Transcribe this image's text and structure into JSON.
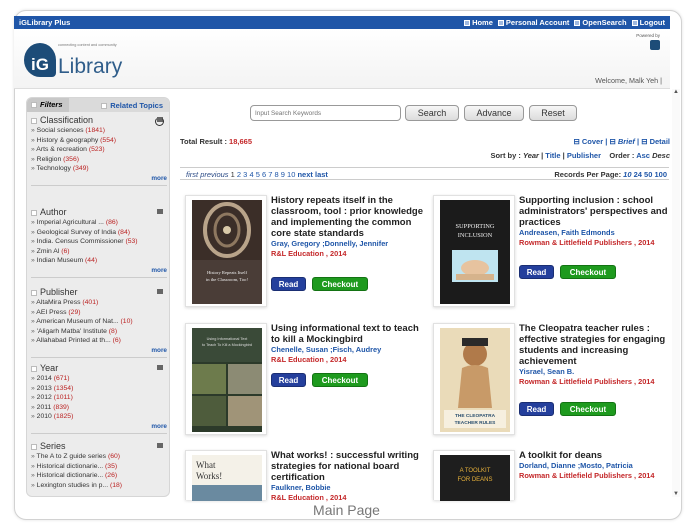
{
  "app": {
    "brand": "iGLibrary Plus"
  },
  "toplinks": [
    {
      "label": "Home"
    },
    {
      "label": "Personal Account"
    },
    {
      "label": "OpenSearch"
    },
    {
      "label": "Logout"
    }
  ],
  "header": {
    "logo_ig": "iG",
    "logo_library": "Library",
    "logo_tag": "connecting content and community",
    "powered_by": "Powered by",
    "welcome": "Welcome, Malk Yeh |"
  },
  "sidebar": {
    "tab_filters": "Filters",
    "tab_related": "Related Topics",
    "more": "more",
    "facets": [
      {
        "title": "Classification",
        "items": [
          {
            "label": "Social sciences",
            "count": "(1841)"
          },
          {
            "label": "History & geography",
            "count": "(554)"
          },
          {
            "label": "Arts & recreation",
            "count": "(523)"
          },
          {
            "label": "Religion",
            "count": "(356)"
          },
          {
            "label": "Technology",
            "count": "(349)"
          }
        ]
      },
      {
        "title": "Author",
        "items": [
          {
            "label": "Imperial Agricultural ...",
            "count": "(86)"
          },
          {
            "label": "Geological Survey of India",
            "count": "(84)"
          },
          {
            "label": "India. Census Commissioner",
            "count": "(53)"
          },
          {
            "label": "Zmin Al",
            "count": "(6)"
          },
          {
            "label": "Indian Museum",
            "count": "(44)"
          }
        ]
      },
      {
        "title": "Publisher",
        "items": [
          {
            "label": "AltaMira Press",
            "count": "(401)"
          },
          {
            "label": "AEI Press",
            "count": "(29)"
          },
          {
            "label": "American Museum of Nat...",
            "count": "(10)"
          },
          {
            "label": "'Aligarh Matba' Institute",
            "count": "(8)"
          },
          {
            "label": "Allahabad Printed at th...",
            "count": "(6)"
          }
        ]
      },
      {
        "title": "Year",
        "items": [
          {
            "label": "2014",
            "count": "(671)"
          },
          {
            "label": "2013",
            "count": "(1354)"
          },
          {
            "label": "2012",
            "count": "(1011)"
          },
          {
            "label": "2011",
            "count": "(839)"
          },
          {
            "label": "2010",
            "count": "(1825)"
          }
        ]
      },
      {
        "title": "Series",
        "items": [
          {
            "label": "The A to Z guide series",
            "count": "(60)"
          },
          {
            "label": "Historical dictionarie...",
            "count": "(35)"
          },
          {
            "label": "Historical dictionarie...",
            "count": "(26)"
          },
          {
            "label": "Lexington studies in p...",
            "count": "(18)"
          }
        ]
      }
    ]
  },
  "search": {
    "placeholder": "Input Search Keywords",
    "search_label": "Search",
    "advance_label": "Advance",
    "reset_label": "Reset"
  },
  "results": {
    "total_label": "Total Result :",
    "total_value": "18,665",
    "views": {
      "cover": "Cover",
      "brief": "Brief",
      "detail": "Detail"
    },
    "sort_label": "Sort by :",
    "sort_year": "Year",
    "sort_title": "Title",
    "sort_publisher": "Publisher",
    "order_label": "Order :",
    "order_asc": "Asc",
    "order_desc": "Desc",
    "pager": {
      "first": "first",
      "previous": "previous",
      "current": "1",
      "pages": [
        "2",
        "3",
        "4",
        "5",
        "6",
        "7",
        "8",
        "9",
        "10"
      ],
      "next": "next",
      "last": "last"
    },
    "per_page_label": "Records Per Page:",
    "per_page_options": [
      "10",
      "24",
      "50",
      "100"
    ]
  },
  "books": [
    {
      "title": "History repeats itself in the classroom, tool : prior knowledge and implementing the common core state standards",
      "authors": "Gray, Gregory ;Donnelly, Jennifer",
      "publisher": "R&L Education , 2014",
      "read": "Read",
      "checkout": "Checkout",
      "cover_text": "History Repeats Itself in the Classroom, Too!"
    },
    {
      "title": "Supporting inclusion : school administrators' perspectives and practices",
      "authors": "Andreasen, Faith Edmonds",
      "publisher": "Rowman & Littlefield Publishers , 2014",
      "read": "Read",
      "checkout": "Checkout",
      "cover_text": "SUPPORTING INCLUSION"
    },
    {
      "title": "Using informational text to teach to kill a Mockingbird",
      "authors": "Chenelle, Susan ;Fisch, Audrey",
      "publisher": "R&L Education , 2014",
      "read": "Read",
      "checkout": "Checkout",
      "cover_text": "Using Informational Text to Teach To Kill a Mockingbird"
    },
    {
      "title": "The Cleopatra teacher rules : effective strategies for engaging students and increasing achievement",
      "authors": "Yisrael, Sean B.",
      "publisher": "Rowman & Littlefield Publishers , 2014",
      "read": "Read",
      "checkout": "Checkout",
      "cover_text": "THE CLEOPATRA TEACHER RULES"
    },
    {
      "title": "What works! : successful writing strategies for national board certification",
      "authors": "Faulkner, Bobbie",
      "publisher": "R&L Education , 2014",
      "cover_text": "What Works!"
    },
    {
      "title": "A toolkit for deans",
      "authors": "Dorland, Dianne ;Mosto, Patricia",
      "publisher": "Rowman & Littlefield Publishers , 2014",
      "cover_text": "A TOOLKIT FOR DEANS"
    }
  ],
  "caption": "Main Page",
  "colors": {
    "topbar": "#1f56a8",
    "link": "#1f56a8",
    "publisher": "#c4282a",
    "read": "#243f9c",
    "checkout": "#1e9a1e"
  }
}
